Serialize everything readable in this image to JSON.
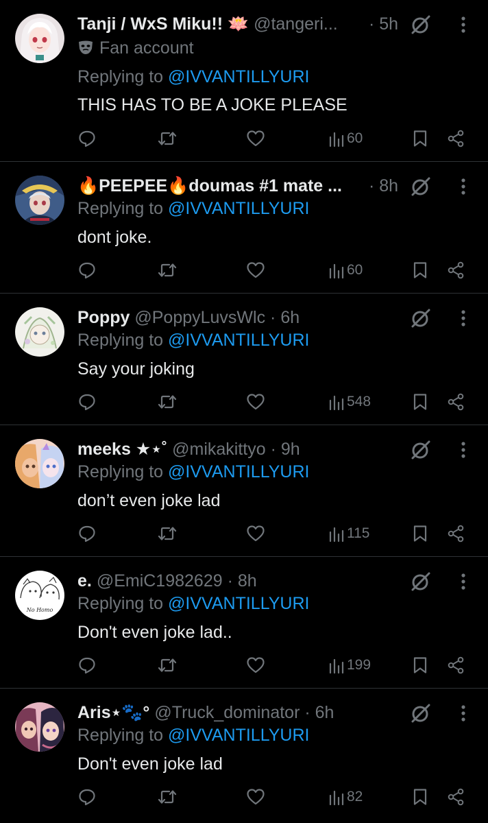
{
  "colors": {
    "background": "#000000",
    "text": "#e7e9ea",
    "muted": "#71767b",
    "link": "#1d9bf0",
    "divider": "#2f3336"
  },
  "replying_prefix": "Replying to",
  "tweets": [
    {
      "name": "Tanji / WxS Miku!! 🪷",
      "handle": "@tangeri...",
      "time": "· 5h",
      "fan_label": "Fan account",
      "reply_to": "@IVVANTILLYURI",
      "text": "THIS HAS TO BE A JOKE PLEASE",
      "views": "60",
      "avatar": "anime-girl-white-hair"
    },
    {
      "name": "🔥PEEPEE🔥doumas #1 mate ...",
      "handle": "",
      "time": "· 8h",
      "reply_to": "@IVVANTILLYURI",
      "text": "dont joke.",
      "views": "60",
      "avatar": "anime-character-hat"
    },
    {
      "name": "Poppy",
      "handle": "@PoppyLuvsWlc",
      "time": "· 6h",
      "reply_to": "@IVVANTILLYURI",
      "text": "Say your joking",
      "views": "548",
      "avatar": "sketch-character-green"
    },
    {
      "name": "meeks ★⋆˚",
      "handle": "@mikakittyo",
      "time": "· 9h",
      "reply_to": "@IVVANTILLYURI",
      "text": "don’t even joke lad",
      "views": "115",
      "avatar": "anime-duo-pink"
    },
    {
      "name": "e.",
      "handle": "@EmiC1982629",
      "time": "· 8h",
      "reply_to": "@IVVANTILLYURI",
      "text": "Don't even joke lad..",
      "views": "199",
      "avatar": "line-drawing-duo",
      "avatar_caption": "No Homo"
    },
    {
      "name": "Aris⋆🐾°",
      "handle": "@Truck_dominator",
      "time": "· 6h",
      "reply_to": "@IVVANTILLYURI",
      "text": "Don't even joke lad",
      "views": "82",
      "avatar": "anime-duo-purple"
    }
  ],
  "icons": [
    "reply-icon",
    "retweet-icon",
    "like-icon",
    "views-icon",
    "bookmark-icon",
    "share-icon",
    "grok-icon",
    "more-icon"
  ]
}
